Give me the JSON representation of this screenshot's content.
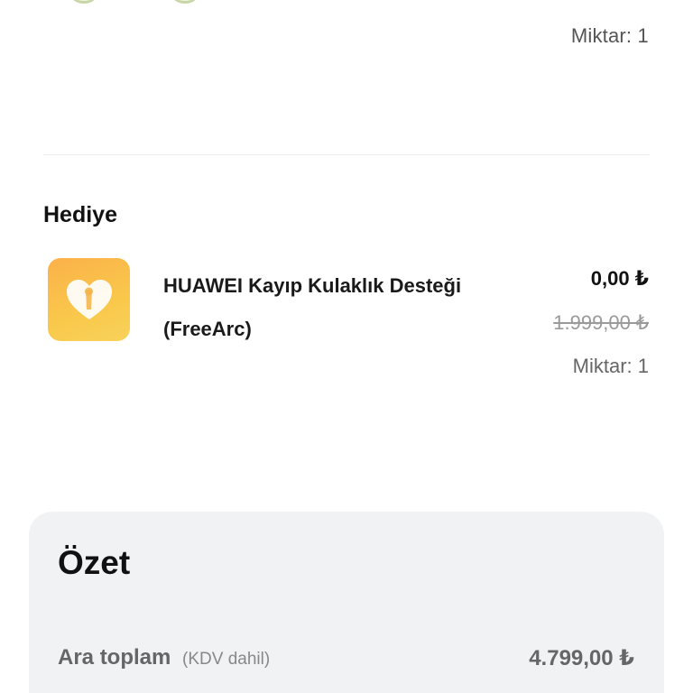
{
  "previous_item": {
    "quantity_text": "Miktar: 1"
  },
  "gift_section": {
    "title": "Hediye",
    "item": {
      "icon": "heart-lock-icon",
      "name": "HUAWEI Kayıp Kulaklık Desteği (FreeArc)",
      "price": "0,00 ₺",
      "original_price": "1.999,00 ₺",
      "quantity_text": "Miktar: 1"
    }
  },
  "summary": {
    "title": "Özet",
    "subtotal_label": "Ara toplam",
    "subtotal_note": "(KDV dahil)",
    "subtotal_value": "4.799,00 ₺"
  },
  "colors": {
    "icon_gradient_start": "#fbb14a",
    "icon_gradient_end": "#f8d25a",
    "summary_background": "#f1f2f4"
  }
}
